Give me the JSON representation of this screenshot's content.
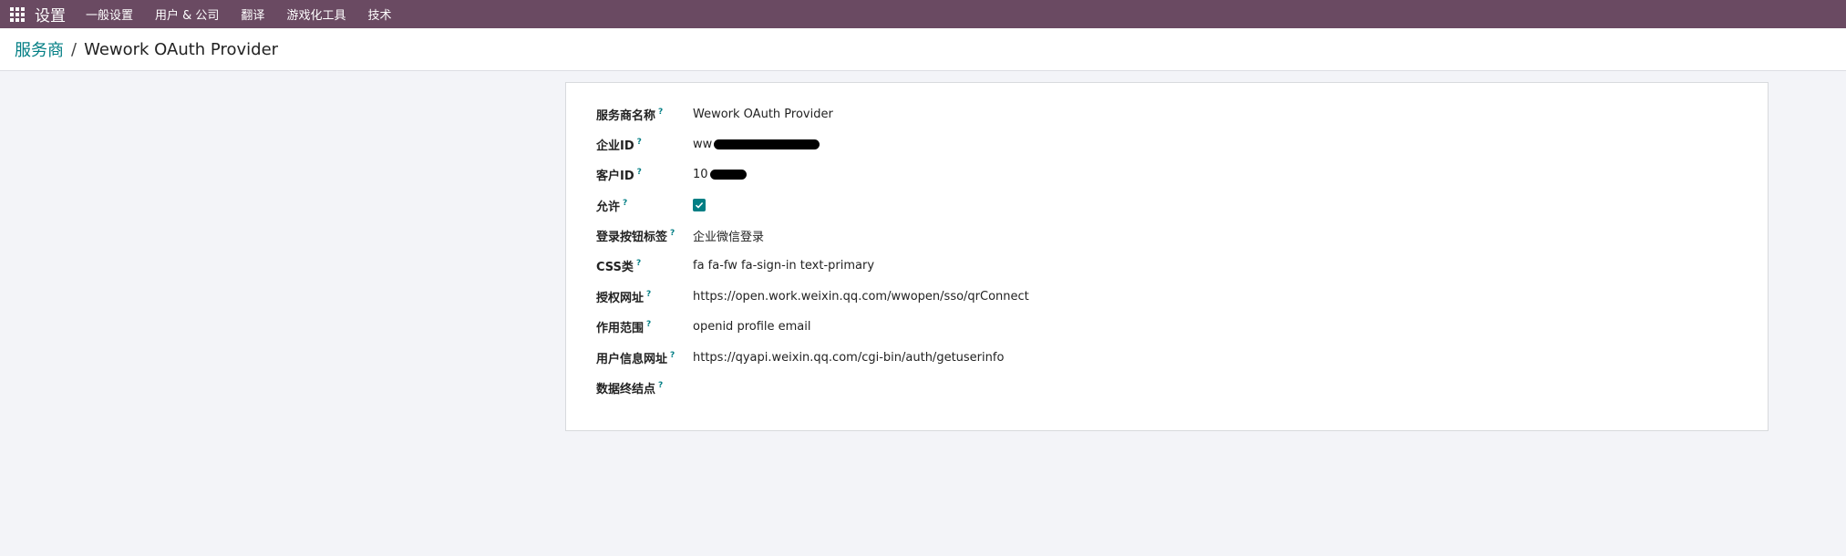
{
  "navbar": {
    "brand": "设置",
    "menu": [
      "一般设置",
      "用户 & 公司",
      "翻译",
      "游戏化工具",
      "技术"
    ]
  },
  "breadcrumb": {
    "parent": "服务商",
    "separator": "/",
    "current": "Wework OAuth Provider"
  },
  "form": {
    "fields": [
      {
        "label": "服务商名称",
        "value": "Wework OAuth Provider"
      },
      {
        "label": "企业ID",
        "value": "ww",
        "redacted": true
      },
      {
        "label": "客户ID",
        "value": "10",
        "redacted": true
      },
      {
        "label": "允许",
        "value": "checked"
      },
      {
        "label": "登录按钮标签",
        "value": "企业微信登录"
      },
      {
        "label": "CSS类",
        "value": "fa fa-fw fa-sign-in text-primary"
      },
      {
        "label": "授权网址",
        "value": "https://open.work.weixin.qq.com/wwopen/sso/qrConnect"
      },
      {
        "label": "作用范围",
        "value": "openid profile email"
      },
      {
        "label": "用户信息网址",
        "value": "https://qyapi.weixin.qq.com/cgi-bin/auth/getuserinfo"
      },
      {
        "label": "数据终结点",
        "value": ""
      }
    ],
    "help_marker": "?"
  },
  "colors": {
    "navbar": "#6a4a62",
    "accent": "#017e84",
    "background": "#f3f4f8"
  }
}
